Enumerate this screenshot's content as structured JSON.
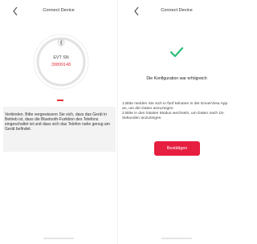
{
  "left_screen": {
    "header": {
      "title": "Connect Device",
      "back_icon": "chevron-left-icon"
    },
    "device": {
      "label": "EVT SN",
      "serial": "39899148"
    },
    "instruction": "Verbinden. Bitte vergewissern Sie sich, dass das Gerät in Betrieb ist, dass die Bluetooth-Funktion des Telefons eingeschaltet ist und dass sich das Telefon nahe genug am Gerät befindet."
  },
  "right_screen": {
    "header": {
      "title": "Connect Device",
      "back_icon": "chevron-left-icon"
    },
    "success_icon": "checkmark-icon",
    "success_message": "Die Konfiguration war erfolgreich",
    "instructions": [
      "1.Bitte melden Sie sich in fünf Minuten in der EnverView App an, um die Daten anzuzeigen",
      "2.Bitte in den lokalen Modus wechseln, um Daten nach 15-Sekunden anzuzeigen"
    ],
    "confirm_label": "Bestätigen"
  },
  "colors": {
    "accent_red": "#e61e3f",
    "success_green": "#2bbf78",
    "info_bg": "#f3f3f3"
  }
}
